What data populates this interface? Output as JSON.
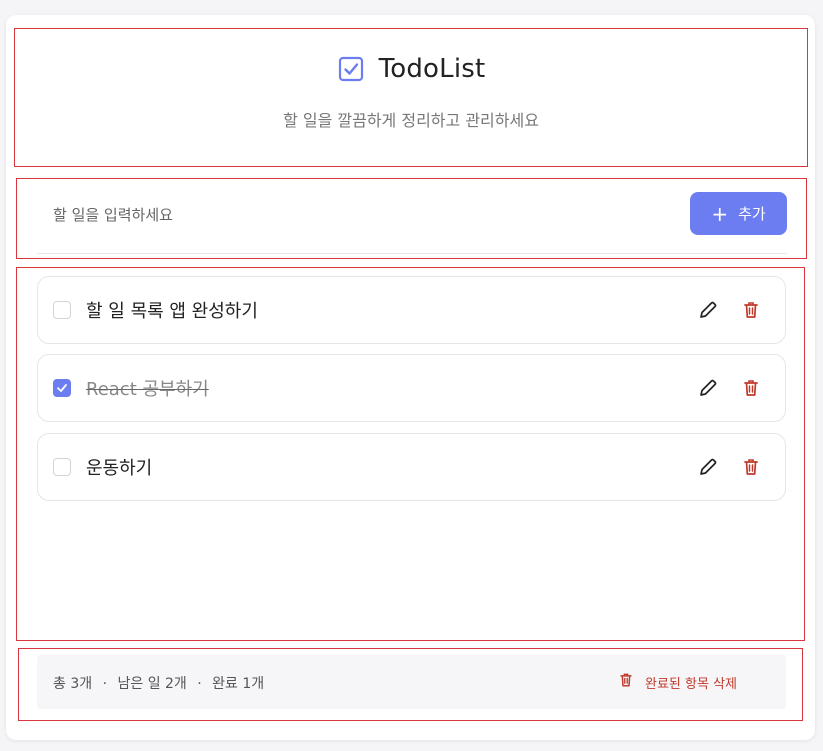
{
  "header": {
    "icon": "checkbox-icon",
    "title": "TodoList",
    "subtitle": "할 일을 깔끔하게 정리하고 관리하세요"
  },
  "input": {
    "placeholder": "할 일을 입력하세요",
    "value": "",
    "add_label": "추가",
    "add_icon": "plus-icon"
  },
  "todos": [
    {
      "text": "할 일 목록 앱 완성하기",
      "completed": false
    },
    {
      "text": "React 공부하기",
      "completed": true
    },
    {
      "text": "운동하기",
      "completed": false
    }
  ],
  "footer": {
    "total": "총 3개",
    "remaining": "남은 일 2개",
    "completed": "완료 1개",
    "separator": "·",
    "clear_label": "완료된 항목 삭제"
  },
  "colors": {
    "accent": "#6b7df0",
    "danger": "#c0392b",
    "highlight_border": "#d9363e"
  }
}
